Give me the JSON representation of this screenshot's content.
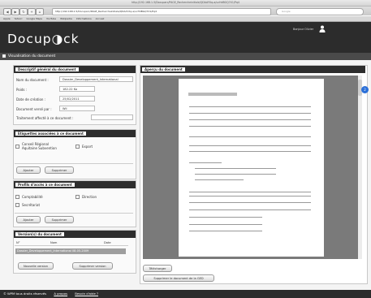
{
  "browser": {
    "title": "http://192.168.1.5/Docuparc/PAGE_Rechercheinitiale/QDAAYXq-a/ucHdBGQ7X1/Pq4",
    "url": "http://192.168.1.5/Docuparc/PAGE_Rechercheinitiale/QDAAYXq-a/ucHdBGQ7X1/Pq4",
    "search_placeholder": "Google",
    "bookmarks": [
      "Apple",
      "Yahoo!",
      "Google Maps",
      "YouTube",
      "Wikipedia",
      "Informations",
      "Accueil"
    ]
  },
  "app": {
    "logo": "Docup◑ck",
    "user_name": "Bonjour Olivier",
    "section_title": "Visualisation du document"
  },
  "general": {
    "heading": "Descriptif général du document",
    "name_label": "Nom du document :",
    "name_value": "Dossier_Developpement_International",
    "weight_label": "Poids :",
    "weight_value": "182.22 Ko",
    "date_label": "Date de création :",
    "date_value": "25/02/2011",
    "filed_by_label": "Document versé par :",
    "filed_by_value": "Wil",
    "treatment_label": "Traitement affecté à ce document :",
    "treatment_value": ""
  },
  "tags": {
    "heading": "Etiquettes associées à ce document",
    "items": [
      "Conseil Régional Aquitaine Subvention",
      "Export"
    ],
    "add_label": "Ajouter",
    "remove_label": "Supprimer"
  },
  "access": {
    "heading": "Profils d'accès à ce document",
    "items": [
      "Comptabilité",
      "Direction",
      "Secrétariat"
    ],
    "add_label": "Ajouter",
    "remove_label": "Supprimer"
  },
  "versions": {
    "heading": "Version(s) du document",
    "col_num": "N°",
    "col_name": "Nom",
    "col_date": "Date",
    "row_text": "Dossier_Developpement_International 08-05-2009",
    "new_label": "Nouvelle version",
    "delete_label": "Supprimer version"
  },
  "preview": {
    "heading": "Aperçu du document",
    "download_label": "Télécharger",
    "delete_doc_label": "Supprimer le document de la GED",
    "badge": "2"
  },
  "footer": {
    "rights": "© WPM tous droits réservés",
    "about_label": "A propos",
    "help_label": "Besoin d'aide ?"
  },
  "colors": {
    "header_bg": "#2c2c2c",
    "badge_blue": "#2a6fd8",
    "selected_row": "#9e9e9e"
  }
}
